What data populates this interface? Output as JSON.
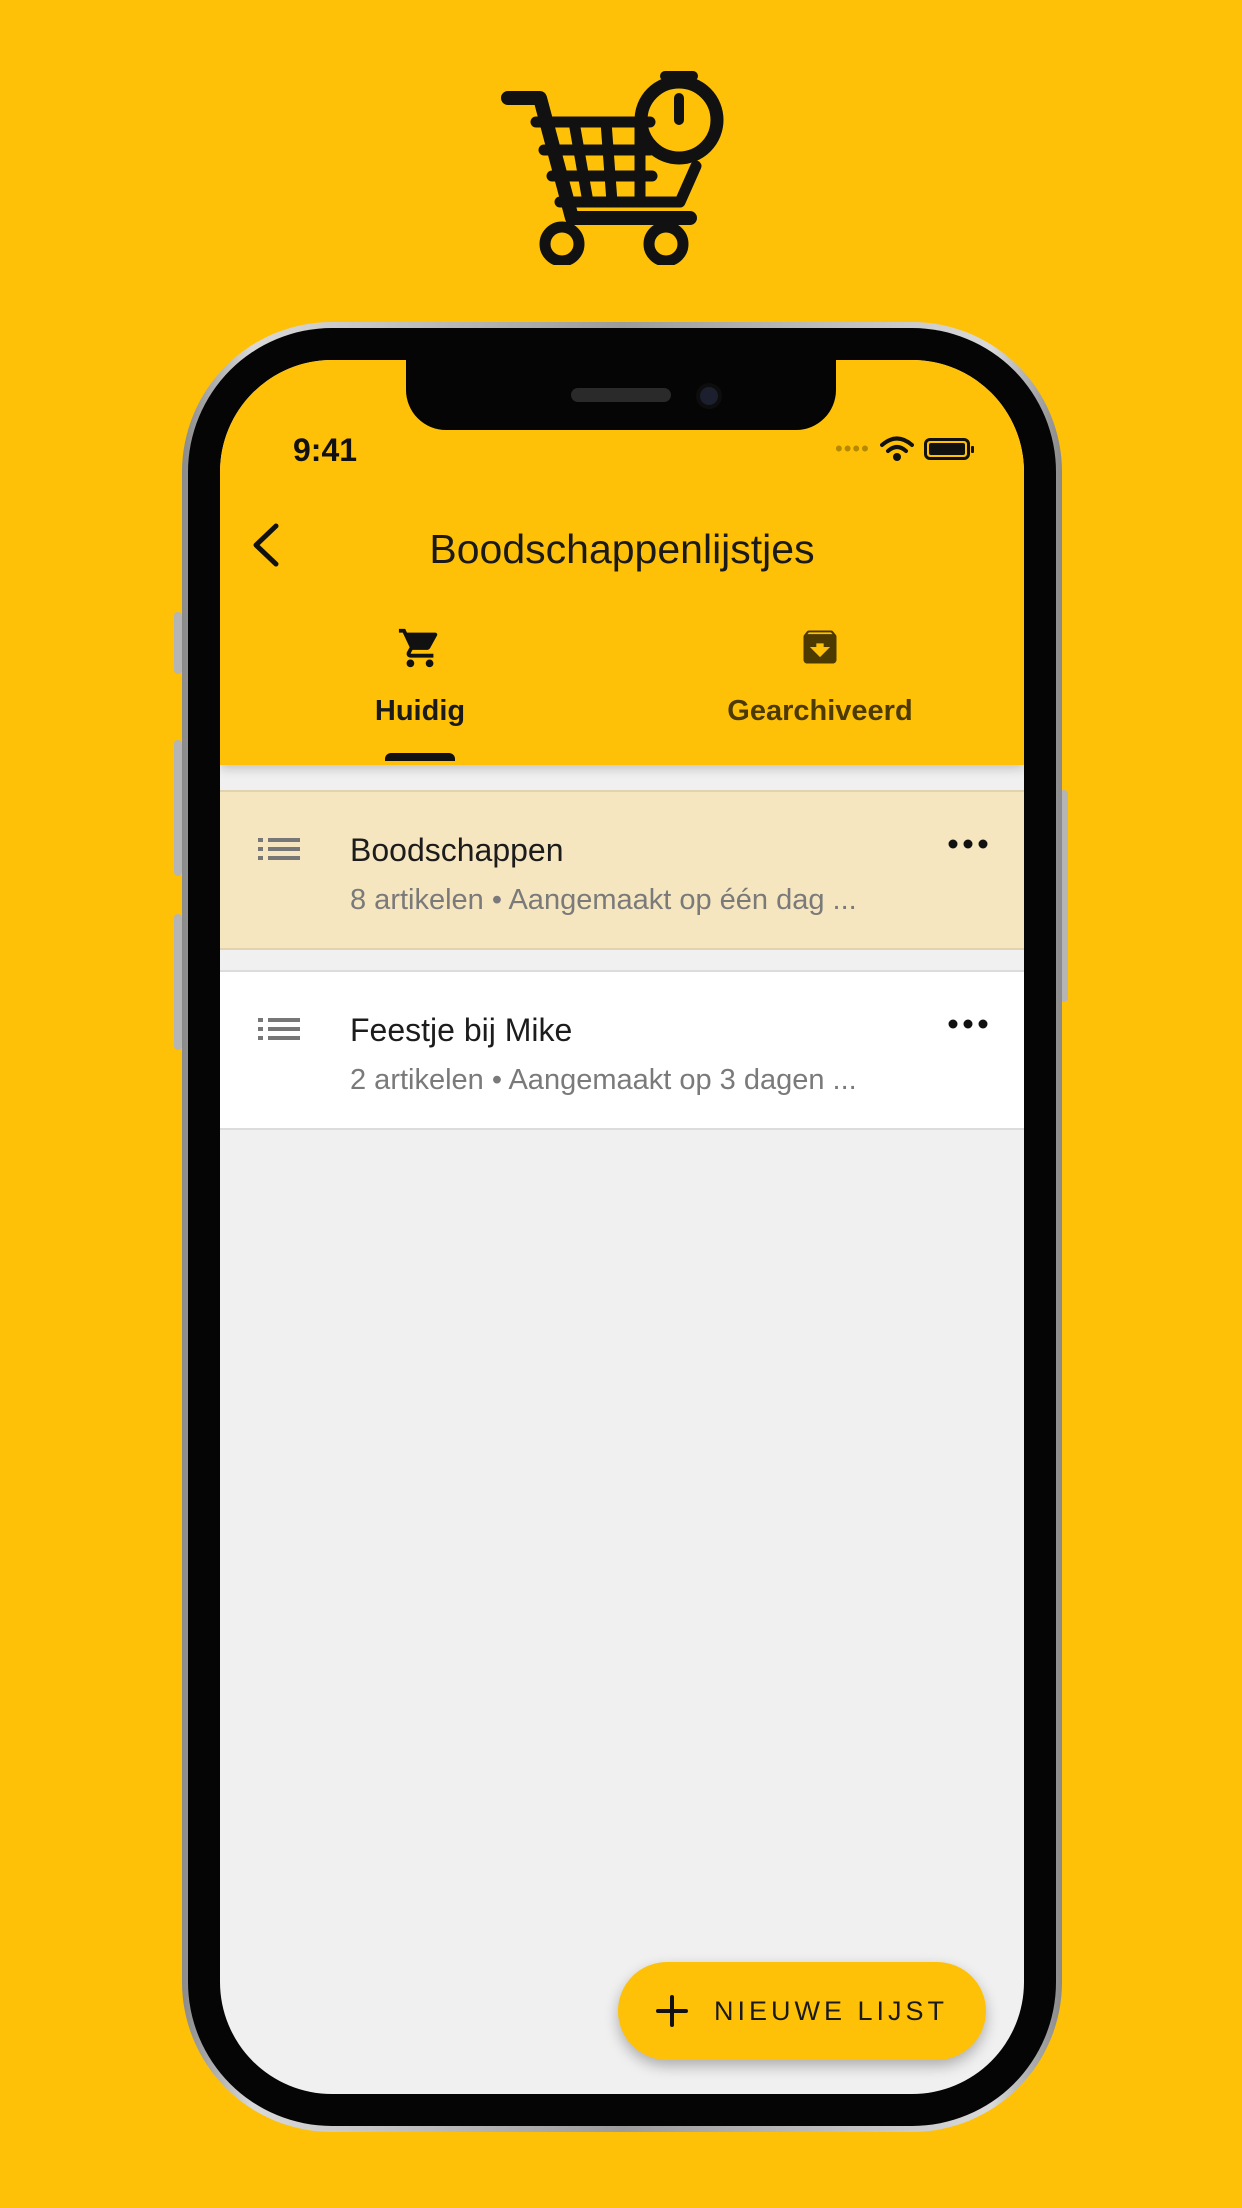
{
  "colors": {
    "accent": "#FFC107",
    "selected_row": "#F5E6C0",
    "background": "#F0F0F0"
  },
  "icons": {
    "logo": "cart-timer-icon",
    "back": "chevron-left-icon",
    "tab_current": "shopping-cart-icon",
    "tab_archived": "archive-icon",
    "list": "list-icon",
    "more": "more-horizontal-icon",
    "fab": "plus-icon"
  },
  "status_bar": {
    "time": "9:41"
  },
  "header": {
    "title": "Boodschappenlijstjes"
  },
  "tabs": [
    {
      "label": "Huidig",
      "selected": true
    },
    {
      "label": "Gearchiveerd",
      "selected": false
    }
  ],
  "lists": [
    {
      "title": "Boodschappen",
      "subtitle": "8 artikelen • Aangemaakt op één dag ...",
      "highlighted": true
    },
    {
      "title": "Feestje bij Mike",
      "subtitle": "2 artikelen • Aangemaakt op 3 dagen ...",
      "highlighted": false
    }
  ],
  "fab": {
    "label": "NIEUWE LIJST"
  }
}
